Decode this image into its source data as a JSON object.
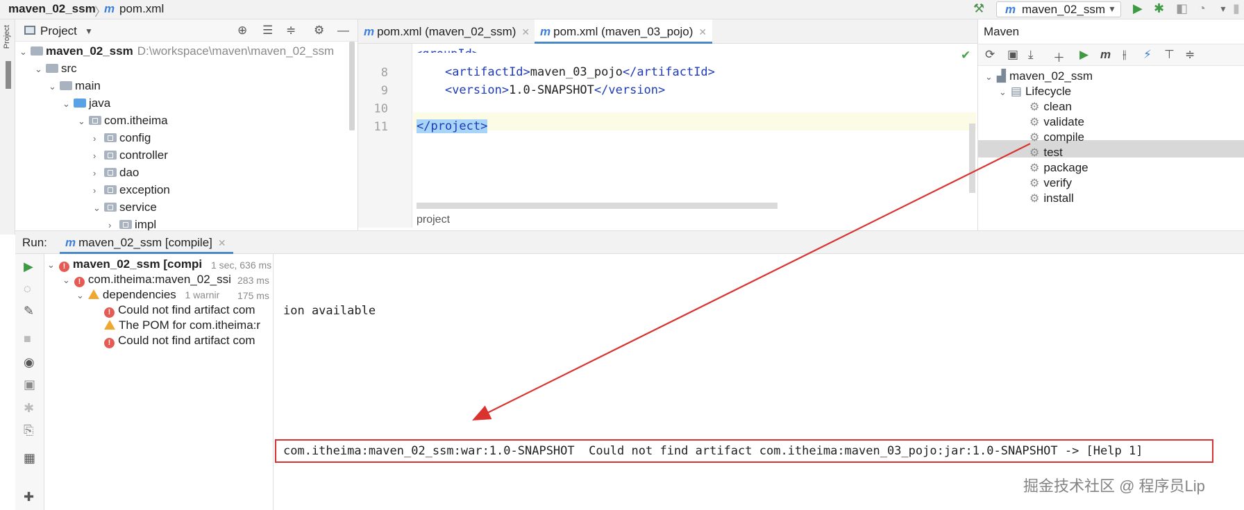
{
  "navbar": {
    "project": "maven_02_ssm",
    "separator": "〉",
    "file_icon": "m",
    "file": "pom.xml",
    "run_config_icon": "m",
    "run_config": "maven_02_ssm"
  },
  "side_strip": {
    "label": "Project"
  },
  "project_panel": {
    "title": "Project",
    "tree": [
      {
        "label": "maven_02_ssm",
        "hint": "D:\\workspace\\maven\\maven_02_ssm"
      },
      {
        "label": "src"
      },
      {
        "label": "main"
      },
      {
        "label": "java"
      },
      {
        "label": "com.itheima"
      },
      {
        "label": "config"
      },
      {
        "label": "controller"
      },
      {
        "label": "dao"
      },
      {
        "label": "exception"
      },
      {
        "label": "service"
      },
      {
        "label": "impl"
      }
    ]
  },
  "editor": {
    "tabs": [
      {
        "icon": "m",
        "label": "pom.xml (maven_02_ssm)"
      },
      {
        "icon": "m",
        "label": "pom.xml (maven_03_pojo)"
      }
    ],
    "lines": [
      {
        "no": "8",
        "indent": "    ",
        "open": "<artifactId>",
        "text": "maven_03_pojo",
        "close": "</artifactId>"
      },
      {
        "no": "9",
        "indent": "    ",
        "open": "<version>",
        "text": "1.0-SNAPSHOT",
        "close": "</version>"
      },
      {
        "no": "10"
      },
      {
        "no": "11",
        "close": "</project>"
      }
    ],
    "status": "project"
  },
  "maven_panel": {
    "title": "Maven",
    "project": "maven_02_ssm",
    "lifecycle": "Lifecycle",
    "goals": [
      "clean",
      "validate",
      "compile",
      "test",
      "package",
      "verify",
      "install"
    ]
  },
  "run_panel": {
    "label": "Run:",
    "tab_icon": "m",
    "tab": "maven_02_ssm [compile]",
    "tree": [
      {
        "label": "maven_02_ssm [compi",
        "time": "1 sec, 636 ms"
      },
      {
        "label": "com.itheima:maven_02_ssi",
        "time": "283 ms"
      },
      {
        "label": "dependencies",
        "meta": "1 warnir",
        "time": "175 ms"
      },
      {
        "label": "Could not find artifact com"
      },
      {
        "label": "The POM for com.itheima:r"
      },
      {
        "label": "Could not find artifact com"
      }
    ],
    "console_line_1": "ion available",
    "console_line_2": "com.itheima:maven_02_ssm:war:1.0-SNAPSHOT  Could not find artifact com.itheima:maven_03_pojo:jar:1.0-SNAPSHOT -> [Help 1]"
  },
  "watermark": "掘金技术社区 @ 程序员Lip",
  "colors": {
    "accent": "#4a88c7",
    "error": "#e55b54",
    "warning": "#f0a732",
    "annotation": "#d9322f",
    "maven_m": "#3d7fd9"
  }
}
